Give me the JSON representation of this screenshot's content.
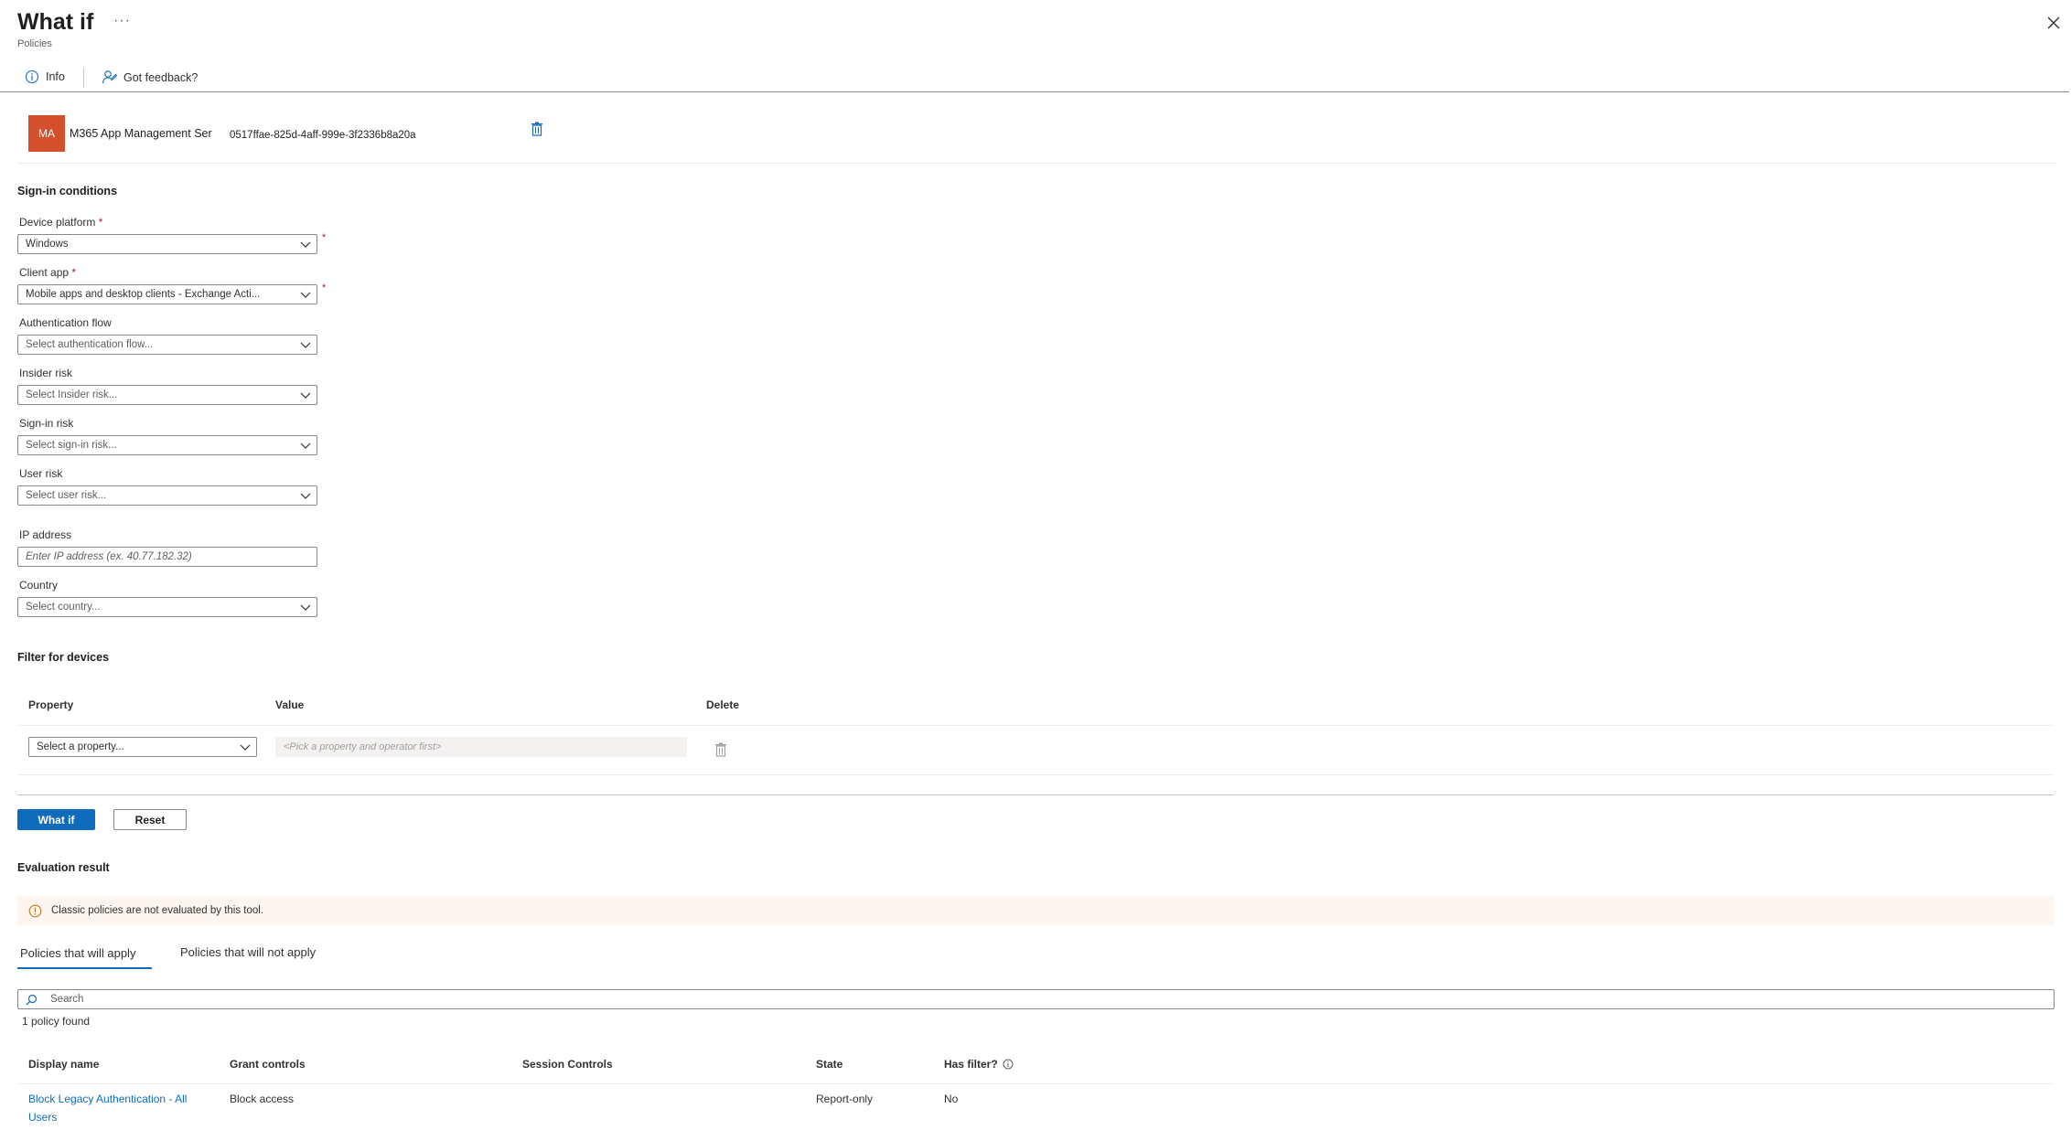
{
  "header": {
    "title": "What if",
    "subtitle": "Policies",
    "more_label": "···"
  },
  "toolbar": {
    "info_label": "Info",
    "feedback_label": "Got feedback?"
  },
  "app": {
    "avatar_initials": "MA",
    "name": "M365 App Management Ser",
    "id": "0517ffae-825d-4aff-999e-3f2336b8a20a"
  },
  "sign_in": {
    "heading": "Sign-in conditions",
    "device_platform": {
      "label": "Device platform",
      "value": "Windows"
    },
    "client_app": {
      "label": "Client app",
      "value": "Mobile apps and desktop clients - Exchange Acti..."
    },
    "auth_flow": {
      "label": "Authentication flow",
      "placeholder": "Select authentication flow..."
    },
    "insider_risk": {
      "label": "Insider risk",
      "placeholder": "Select Insider risk..."
    },
    "sign_in_risk": {
      "label": "Sign-in risk",
      "placeholder": "Select sign-in risk..."
    },
    "user_risk": {
      "label": "User risk",
      "placeholder": "Select user risk..."
    },
    "ip_address": {
      "label": "IP address",
      "placeholder": "Enter IP address (ex. 40.77.182.32)"
    },
    "country": {
      "label": "Country",
      "placeholder": "Select country..."
    },
    "required_mark": "*"
  },
  "filter": {
    "heading": "Filter for devices",
    "columns": [
      "Property",
      "Value",
      "Delete"
    ],
    "property_placeholder": "Select a property...",
    "value_placeholder": "<Pick a property and operator first>"
  },
  "actions": {
    "what_if_label": "What if",
    "reset_label": "Reset"
  },
  "evaluation": {
    "heading": "Evaluation result",
    "banner_text": "Classic policies are not evaluated by this tool.",
    "tabs": [
      "Policies that will apply",
      "Policies that will not apply"
    ],
    "search_placeholder": "Search",
    "count_text": "1 policy found",
    "columns": [
      "Display name",
      "Grant controls",
      "Session Controls",
      "State",
      "Has filter?"
    ],
    "rows": [
      {
        "display_name_line1": "Block Legacy Authentication - All",
        "display_name_line2": "Users",
        "grant": "Block access",
        "session": "",
        "state": "Report-only",
        "has_filter": "No"
      }
    ]
  },
  "colors": {
    "accent": "#0f6cbd",
    "avatar": "#d4502c",
    "required": "#a4262c",
    "banner_bg": "#fdf6f0"
  }
}
